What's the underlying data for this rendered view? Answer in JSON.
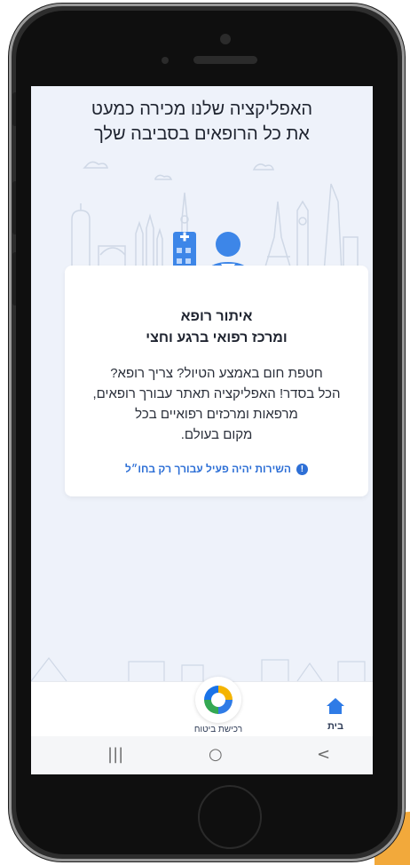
{
  "headline": {
    "line1": "האפליקציה שלנו מכירה כמעט",
    "line2": "את כל הרופאים בסביבה שלך"
  },
  "card": {
    "title_line1": "איתור רופא",
    "title_line2": "ומרכז רפואי ברגע וחצי",
    "body_line1": "חטפת חום באמצע הטיול? צריך רופא?",
    "body_line2": "הכל בסדר! האפליקציה תאתר עבורך רופאים,",
    "body_line3": "מרפאות ומרכזים רפואיים בכל",
    "body_line4": "מקום בעולם.",
    "notice": "השירות יהיה פעיל עבורך רק בחו״ל",
    "notice_icon": "!"
  },
  "tabbar": {
    "home_label": "בית",
    "insurance_label": "רכישת ביטוח"
  },
  "navbar": {
    "recent": "|||",
    "home": "○",
    "back": ">"
  },
  "colors": {
    "accent_blue": "#2d6fd6",
    "screen_bg": "#eef2fa",
    "orange_accent": "#f2a93b"
  }
}
